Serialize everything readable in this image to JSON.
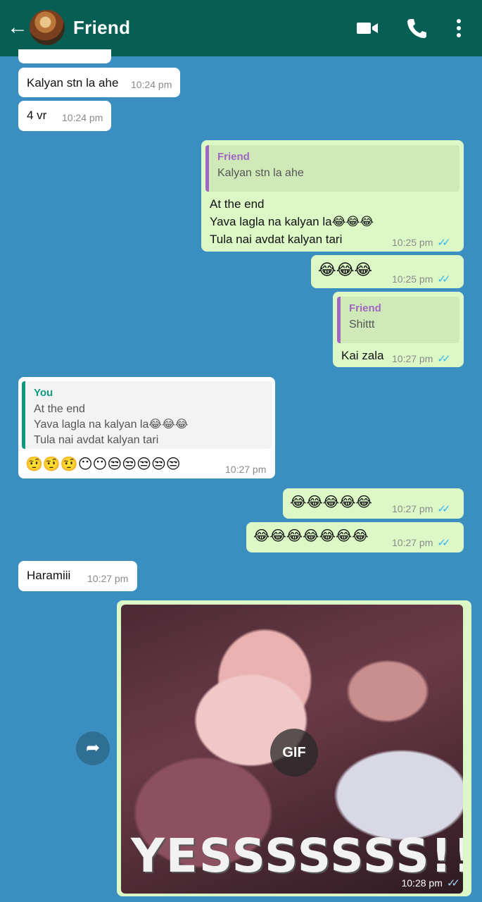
{
  "header": {
    "back_icon": "arrow-left-icon",
    "contact_name": "Friend",
    "avatar": "contact-avatar",
    "video_icon": "video-camera-icon",
    "call_icon": "phone-icon",
    "menu_icon": "more-vertical-icon"
  },
  "messages": [
    {
      "dir": "in",
      "text": "Kalyan stn la ahe",
      "time": "10:24 pm"
    },
    {
      "dir": "in",
      "text": "4 vr",
      "time": "10:24 pm"
    },
    {
      "dir": "out",
      "quote_name": "Friend",
      "quote_text": "Kalyan stn la ahe",
      "text": "At the end\nYava lagla na kalyan la😂😂😂\nTula nai avdat kalyan tari",
      "time": "10:25 pm",
      "ticks": "✓✓"
    },
    {
      "dir": "out",
      "text": "😂😂😂",
      "time": "10:25 pm",
      "ticks": "✓✓"
    },
    {
      "dir": "out",
      "quote_name": "Friend",
      "quote_text": "Shittt",
      "text": "Kai zala",
      "time": "10:27 pm",
      "ticks": "✓✓"
    },
    {
      "dir": "in",
      "quote_name": "You",
      "quote_text": "At the end\nYava lagla na kalyan la😂😂😂\nTula nai avdat kalyan tari",
      "text": "🤨🤨🤨😶😶😒😒😒😒😒",
      "time": "10:27 pm"
    },
    {
      "dir": "out",
      "text": "😂😂😂😂😂",
      "time": "10:27 pm",
      "ticks": "✓✓"
    },
    {
      "dir": "out",
      "text": "😂😂😂😂😂😂😂",
      "time": "10:27 pm",
      "ticks": "✓✓"
    },
    {
      "dir": "in",
      "text": "Haramiii",
      "time": "10:27 pm"
    },
    {
      "dir": "out",
      "gif_badge": "GIF",
      "gif_caption": "YESSSSSSS!!",
      "time": "10:28 pm",
      "ticks": "✓✓"
    }
  ],
  "forward_icon": "share-forward-icon"
}
